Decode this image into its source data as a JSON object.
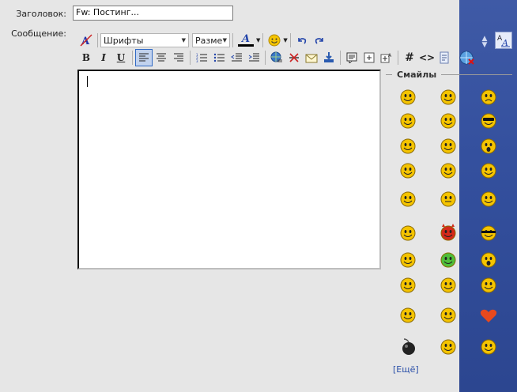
{
  "form": {
    "subject_label": "Заголовок:",
    "subject_value": "Fw: Постинг...",
    "message_label": "Сообщение:"
  },
  "toolbar": {
    "font_select": "Шрифты",
    "size_select": "Разме",
    "font_color_letter": "A",
    "bold": "B",
    "italic": "I",
    "underline": "U",
    "hash": "#",
    "code": "<>"
  },
  "smilies": {
    "title": "Смайлы",
    "more_link": "[Ещё]",
    "items": [
      "angel",
      "smile",
      "sad",
      "smile2",
      "tongue",
      "cool",
      "grin",
      "blush",
      "shocked",
      "pigtails",
      "kiss",
      "wink",
      "thumbsup",
      "neutral",
      "wink2",
      "salute",
      "devil",
      "ninja",
      "wave",
      "green",
      "shout",
      "highfive",
      "friends",
      "rose",
      "smile3",
      "hug",
      "heart",
      "bomb",
      "stop",
      "angry"
    ]
  },
  "colors": {
    "band": "#34509e",
    "accent": "#316ac5",
    "smiley_yellow": "#f5c400"
  }
}
